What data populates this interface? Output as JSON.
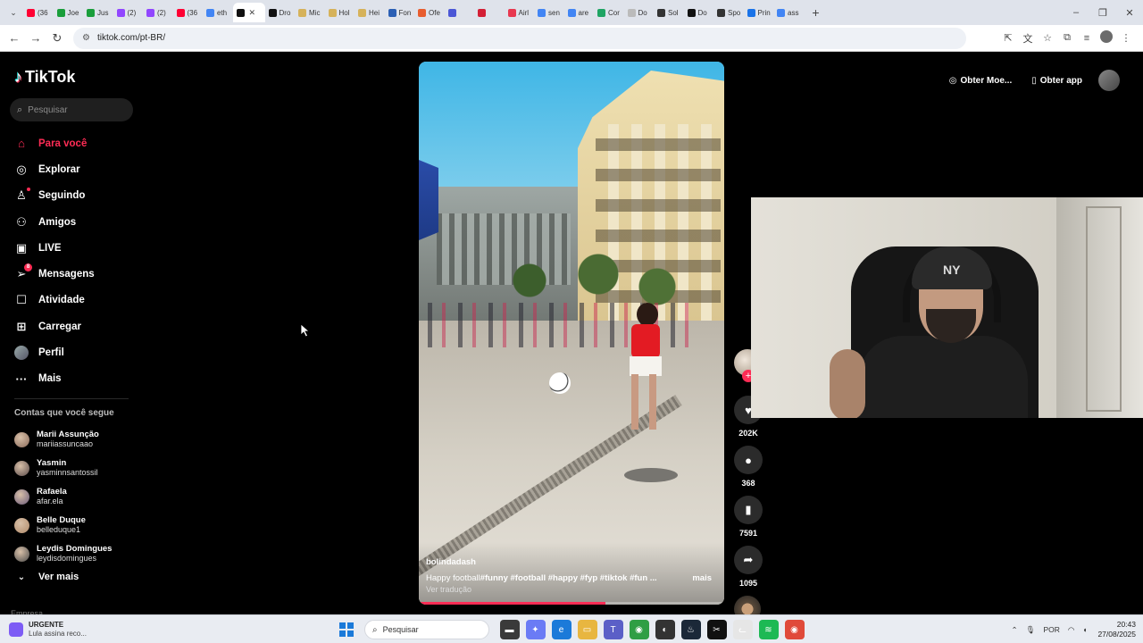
{
  "browser": {
    "tabs": [
      {
        "label": "(36",
        "color": "#ff0033"
      },
      {
        "label": "Joe",
        "color": "#1a9e3b"
      },
      {
        "label": "Jus",
        "color": "#1a9e3b"
      },
      {
        "label": "(2)",
        "color": "#9146ff"
      },
      {
        "label": "(2)",
        "color": "#9146ff"
      },
      {
        "label": "(36",
        "color": "#ff0033"
      },
      {
        "label": "eth",
        "color": "#4285f4"
      },
      {
        "label": "",
        "color": "#111111",
        "active": true
      },
      {
        "label": "Dro",
        "color": "#111111"
      },
      {
        "label": "Mic",
        "color": "#d6b25a"
      },
      {
        "label": "Hol",
        "color": "#d6b25a"
      },
      {
        "label": "Hei",
        "color": "#d6b25a"
      },
      {
        "label": "Fon",
        "color": "#2b5fb4"
      },
      {
        "label": "Ofe",
        "color": "#e85d2f"
      },
      {
        "label": "",
        "color": "#4b57d6"
      },
      {
        "label": "",
        "color": "#d31f35"
      },
      {
        "label": "Airl",
        "color": "#e8384f"
      },
      {
        "label": "sen",
        "color": "#4285f4"
      },
      {
        "label": "are",
        "color": "#4285f4"
      },
      {
        "label": "Cor",
        "color": "#1fa463"
      },
      {
        "label": "Do",
        "color": "#bbbbbb"
      },
      {
        "label": "Sol",
        "color": "#333333"
      },
      {
        "label": "Do",
        "color": "#111111"
      },
      {
        "label": "Spo",
        "color": "#333333"
      },
      {
        "label": "Prin",
        "color": "#1a73e8"
      },
      {
        "label": "ass",
        "color": "#4285f4"
      }
    ],
    "new_tab": "+",
    "url": "tiktok.com/pt-BR/"
  },
  "tiktok": {
    "logo_text": "TikTok",
    "search_placeholder": "Pesquisar",
    "nav": [
      {
        "label": "Para você",
        "icon": "home-icon",
        "glyph": "⌂",
        "active": true
      },
      {
        "label": "Explorar",
        "icon": "compass-icon",
        "glyph": "◎"
      },
      {
        "label": "Seguindo",
        "icon": "following-icon",
        "glyph": "♙",
        "dot": true
      },
      {
        "label": "Amigos",
        "icon": "friends-icon",
        "glyph": "⚇"
      },
      {
        "label": "LIVE",
        "icon": "live-icon",
        "glyph": "▣"
      },
      {
        "label": "Mensagens",
        "icon": "messages-icon",
        "glyph": "➢",
        "badge": "8"
      },
      {
        "label": "Atividade",
        "icon": "activity-icon",
        "glyph": "☐"
      },
      {
        "label": "Carregar",
        "icon": "upload-icon",
        "glyph": "⊞"
      },
      {
        "label": "Perfil",
        "icon": "profile-icon",
        "avatar": true
      },
      {
        "label": "Mais",
        "icon": "more-icon",
        "glyph": "···"
      }
    ],
    "following_title": "Contas que você segue",
    "following": [
      {
        "name": "Marii Assunção",
        "handle": "mariiassuncaao",
        "color": "#8a6a5a"
      },
      {
        "name": "Yasmin",
        "handle": "yasminnsantossil",
        "color": "#5a4a4a"
      },
      {
        "name": "Rafaela",
        "handle": "afar.ela",
        "color": "#6a5a7a"
      },
      {
        "name": "Belle Duque",
        "handle": "belleduque1",
        "color": "#b08a6a"
      },
      {
        "name": "Leydis Domingues",
        "handle": "leydisdomingues",
        "color": "#4a4a4a"
      }
    ],
    "see_more": "Ver mais",
    "footer_partial": "Empresa",
    "top_actions": {
      "coins": "Obter Moe...",
      "app": "Obter app"
    },
    "video": {
      "author": "bolindadash",
      "caption_text": "Happy football",
      "caption_tags": "#funny  #football  #happy  #fyp  #tiktok  #fun  ...",
      "more": "mais",
      "translate": "Ver tradução",
      "progress": 0.61
    },
    "actions": {
      "likes": "202K",
      "comments": "368",
      "saves": "7591",
      "shares": "1095"
    }
  },
  "webcam": {
    "cap_logo": "NY"
  },
  "taskbar": {
    "news_title": "URGENTE",
    "news_sub": "Lula assina reco...",
    "search_placeholder": "Pesquisar",
    "apps": [
      {
        "name": "file-manager-app",
        "color": "#3a3a3a",
        "glyph": "▬"
      },
      {
        "name": "copilot-app",
        "color": "#6a7bf5",
        "glyph": "✦"
      },
      {
        "name": "edge-app",
        "color": "#1b7ad9",
        "glyph": "e"
      },
      {
        "name": "explorer-app",
        "color": "#e8b640",
        "glyph": "▭"
      },
      {
        "name": "teams-app",
        "color": "#5b5fc7",
        "glyph": "T"
      },
      {
        "name": "chrome-app",
        "color": "#2f9e44",
        "glyph": "◉"
      },
      {
        "name": "obs-app",
        "color": "#333333",
        "glyph": "◐"
      },
      {
        "name": "steam-app",
        "color": "#1b2838",
        "glyph": "♨"
      },
      {
        "name": "capcut-app",
        "color": "#111111",
        "glyph": "✂"
      },
      {
        "name": "cat-app",
        "color": "#e6e6e6",
        "glyph": "ᓚ"
      },
      {
        "name": "spotify-app",
        "color": "#1db954",
        "glyph": "≋"
      },
      {
        "name": "chrome-dev-app",
        "color": "#e04a3a",
        "glyph": "◉"
      }
    ],
    "lang": "POR",
    "time": "20:43",
    "date": "27/08/2025"
  }
}
